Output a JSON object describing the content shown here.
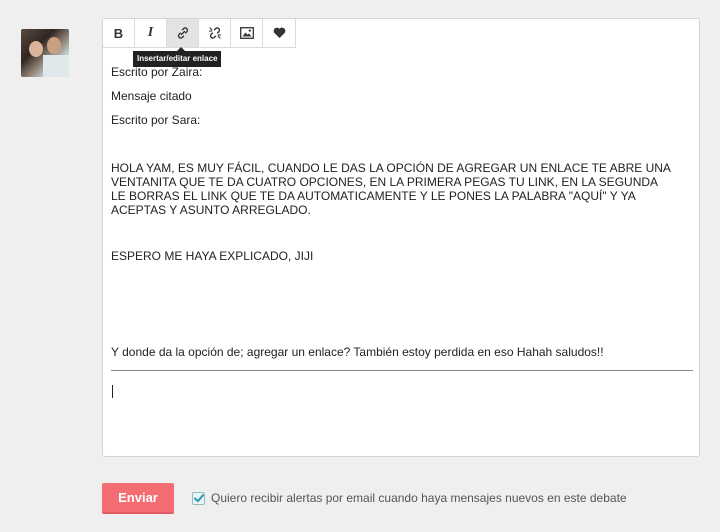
{
  "toolbar": {
    "buttons": [
      {
        "label": "B",
        "icon": "bold-icon"
      },
      {
        "label": "I",
        "icon": "italic-icon"
      },
      {
        "icon": "link-icon"
      },
      {
        "icon": "unlink-icon"
      },
      {
        "icon": "image-icon"
      },
      {
        "icon": "heart-icon"
      }
    ],
    "tooltip": "Insertar/editar enlace"
  },
  "content": {
    "line1": "Escrito por Zaira:",
    "line2": "Mensaje citado",
    "line3": "Escrito por Sara:",
    "para1": "HOLA YAM, ES MUY FÁCIL, CUANDO LE DAS LA OPCIÓN DE AGREGAR UN ENLACE TE ABRE UNA VENTANITA QUE TE DA CUATRO OPCIONES, EN LA PRIMERA PEGAS TU LINK, EN LA SEGUNDA LE BORRAS EL LINK QUE TE DA AUTOMATICAMENTE Y LE PONES LA PALABRA \"AQUÍ\" Y YA ACEPTAS Y ASUNTO ARREGLADO.",
    "para2": "ESPERO ME HAYA EXPLICADO, JIJI",
    "para3": "Y donde da la opción de; agregar un enlace? También estoy perdida en eso Hahah saludos!!"
  },
  "form": {
    "send_label": "Enviar",
    "alert_label": "Quiero recibir alertas por email cuando haya mensajes nuevos en este debate",
    "alert_checked": true
  },
  "colors": {
    "send_button": "#f46d72",
    "background": "#efefef"
  }
}
